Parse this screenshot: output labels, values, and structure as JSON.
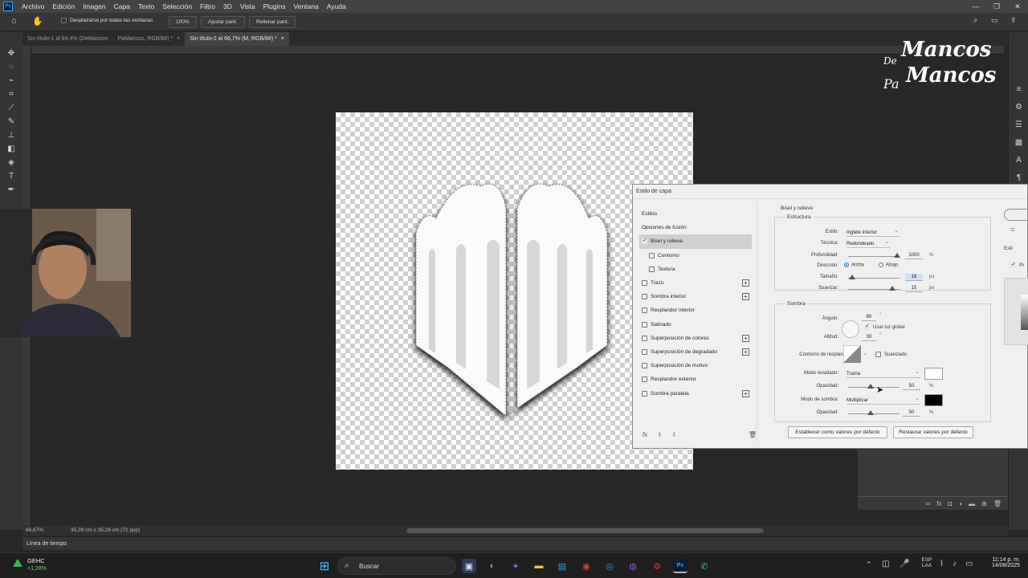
{
  "app": {
    "logo": "Ps",
    "menu": [
      "Archivo",
      "Edición",
      "Imagen",
      "Capa",
      "Texto",
      "Selección",
      "Filtro",
      "3D",
      "Vista",
      "Plugins",
      "Ventana",
      "Ayuda"
    ],
    "window_controls": [
      "—",
      "❐",
      "✕"
    ]
  },
  "options_bar": {
    "scroll_all_windows": "Desplazarse por todas las ventanas",
    "zoom": "100%",
    "fit": "Ajustar pant.",
    "fill": "Rellenar pant."
  },
  "tabs": [
    {
      "label": "Sin título-1 al 84,4% (DeMancos",
      "active": false
    },
    {
      "label": "PaMancos, RGB/8#) *",
      "active": false
    },
    {
      "label": "Sin título-2 al 66,7% (M, RGB/8#) *",
      "active": true
    }
  ],
  "watermark": {
    "line1": "Mancos",
    "de": "De",
    "pa": "Pa",
    "line2": "Mancos"
  },
  "status": {
    "zoom": "66,67%",
    "doc_size": "35,28 cm x 35,28 cm (72 ppp)"
  },
  "timeline_label": "Línea de tiempo",
  "dialog": {
    "title": "Estilo de capa",
    "styles": [
      {
        "label": "Estilos",
        "checkbox": false,
        "header": true
      },
      {
        "label": "Opciones de fusión",
        "checkbox": false,
        "header": true
      },
      {
        "label": "Bisel y relieve",
        "checkbox": true,
        "checked": true,
        "selected": true
      },
      {
        "label": "Contorno",
        "checkbox": true,
        "checked": false,
        "sub": true
      },
      {
        "label": "Textura",
        "checkbox": true,
        "checked": false,
        "sub": true
      },
      {
        "label": "Trazo",
        "checkbox": true,
        "checked": false,
        "plus": true
      },
      {
        "label": "Sombra interior",
        "checkbox": true,
        "checked": false,
        "plus": true
      },
      {
        "label": "Resplandor interior",
        "checkbox": true,
        "checked": false
      },
      {
        "label": "Satinado",
        "checkbox": true,
        "checked": false
      },
      {
        "label": "Superposición de colores",
        "checkbox": true,
        "checked": false,
        "plus": true
      },
      {
        "label": "Superposición de degradado",
        "checkbox": true,
        "checked": false,
        "plus": true
      },
      {
        "label": "Superposición de motivo",
        "checkbox": true,
        "checked": false
      },
      {
        "label": "Resplandor exterior",
        "checkbox": true,
        "checked": false
      },
      {
        "label": "Sombra paralela",
        "checkbox": true,
        "checked": false,
        "plus": true
      }
    ],
    "bevel": {
      "section": "Bisel y relieve",
      "structure": "Estructura",
      "style_label": "Estilo:",
      "style_value": "Inglete interior",
      "technique_label": "Técnica:",
      "technique_value": "Redondeado",
      "depth_label": "Profundidad:",
      "depth_value": "1000",
      "depth_unit": "%",
      "direction_label": "Dirección:",
      "dir_up": "Arriba",
      "dir_down": "Abajo",
      "size_label": "Tamaño:",
      "size_value": "16",
      "size_unit": "px",
      "soften_label": "Suavizar:",
      "soften_value": "15",
      "soften_unit": "px"
    },
    "shading": {
      "section": "Sombra",
      "angle_label": "Ángulo:",
      "angle_value": "90",
      "deg": "°",
      "global_light": "Usar luz global",
      "altitude_label": "Altitud:",
      "altitude_value": "30",
      "gloss_label": "Contorno de resplandor:",
      "antialias": "Suavizado",
      "highlight_mode_label": "Modo resaltado:",
      "highlight_mode": "Trama",
      "opacity_label": "Opacidad:",
      "opacity1_value": "50",
      "pct": "%",
      "shadow_mode_label": "Modo de sombra:",
      "shadow_mode": "Multiplicar",
      "opacity2_value": "50",
      "highlight_color": "#ffffff",
      "shadow_color": "#000000"
    },
    "buttons": {
      "make_default": "Establecer como valores por defecto",
      "reset_default": "Restaurar valores por defecto"
    },
    "right_partial": {
      "preview": "Pr",
      "new_style": "Esti"
    }
  },
  "taskbar": {
    "weather_name": "GEHC",
    "weather_change": "+1,28%",
    "search": "Buscar",
    "lang1": "ESP",
    "lang2": "LAA",
    "time": "11:14 p. m.",
    "date": "14/08/2025"
  }
}
